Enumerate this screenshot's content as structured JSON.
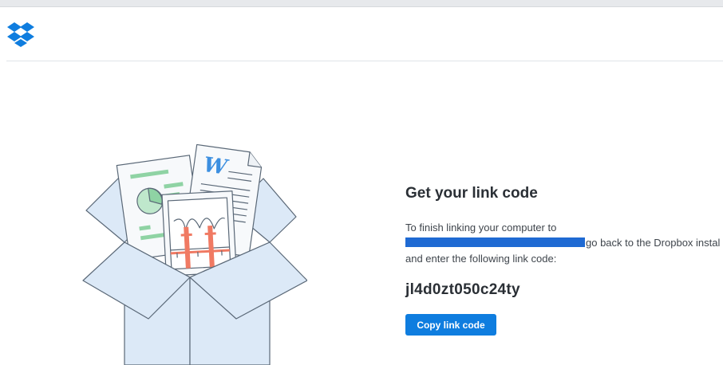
{
  "header": {
    "logo_icon": "dropbox-logo-icon",
    "brand_color": "#0f7ddf"
  },
  "main": {
    "title": "Get your link code",
    "instruction_line1": "To finish linking your computer to",
    "instruction_line2_tail": "go back to the Dropbox instal",
    "instruction_line3": "and enter the following link code:",
    "link_code": "jl4d0zt050c24ty",
    "copy_button_label": "Copy link code"
  },
  "illustration": {
    "icon": "open-box-with-documents-icon",
    "word_glyph": "W"
  },
  "colors": {
    "button_bg": "#0f7ddf",
    "redaction": "#1f6ad3",
    "box_fill": "#dce9f7",
    "box_stroke": "#5a6877"
  }
}
